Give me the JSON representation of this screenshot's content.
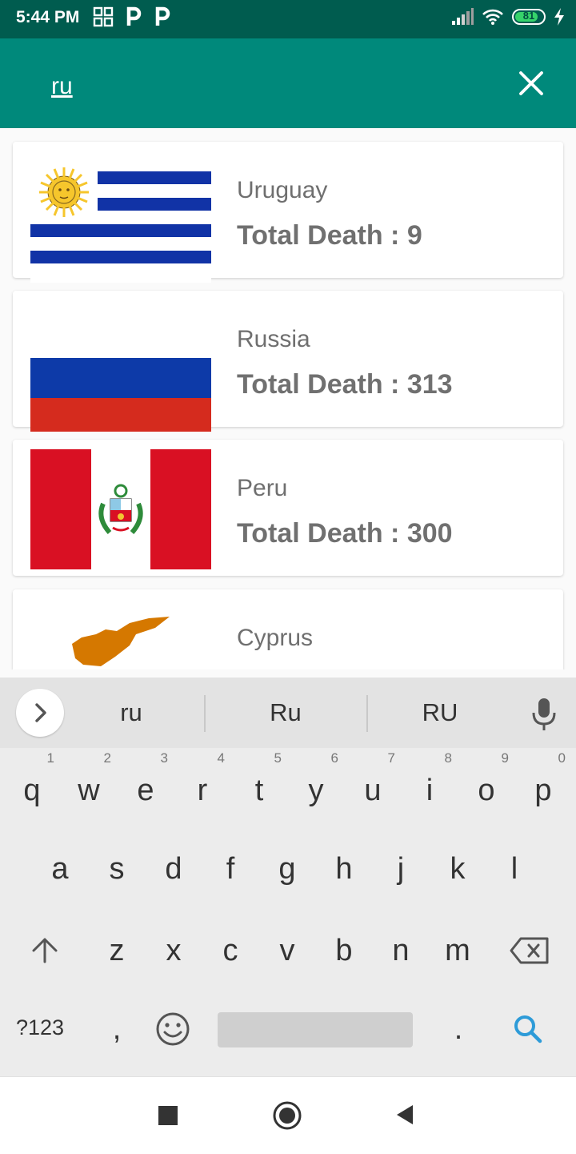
{
  "status_bar": {
    "time": "5:44 PM",
    "battery_level": "81",
    "icons": [
      "notification-grid-icon",
      "p-app-icon",
      "p-app-icon",
      "signal-icon",
      "wifi-icon",
      "battery-icon",
      "charging-icon"
    ]
  },
  "search": {
    "value": "ru",
    "close_icon": "close-icon"
  },
  "countries": [
    {
      "name": "Uruguay",
      "deaths_text": "Total Death : 9",
      "flag": "uruguay-flag"
    },
    {
      "name": "Russia",
      "deaths_text": "Total Death : 313",
      "flag": "russia-flag"
    },
    {
      "name": "Peru",
      "deaths_text": "Total Death : 300",
      "flag": "peru-flag"
    },
    {
      "name": "Cyprus",
      "deaths_text": "",
      "flag": "cyprus-flag"
    }
  ],
  "keyboard": {
    "suggestions": [
      "ru",
      "Ru",
      "RU"
    ],
    "row1": [
      "q",
      "w",
      "e",
      "r",
      "t",
      "y",
      "u",
      "i",
      "o",
      "p"
    ],
    "row1_hints": [
      "1",
      "2",
      "3",
      "4",
      "5",
      "6",
      "7",
      "8",
      "9",
      "0"
    ],
    "row2": [
      "a",
      "s",
      "d",
      "f",
      "g",
      "h",
      "j",
      "k",
      "l"
    ],
    "row3": [
      "z",
      "x",
      "c",
      "v",
      "b",
      "n",
      "m"
    ],
    "bottom": {
      "symbols": "?123",
      "comma": ",",
      "period": "."
    },
    "accent_color": "#2d9bd8"
  },
  "colors": {
    "app_bar": "#00897b",
    "status_bar": "#005c4f"
  },
  "nav_bar": {
    "icons": [
      "recents-icon",
      "home-icon",
      "back-icon"
    ]
  }
}
